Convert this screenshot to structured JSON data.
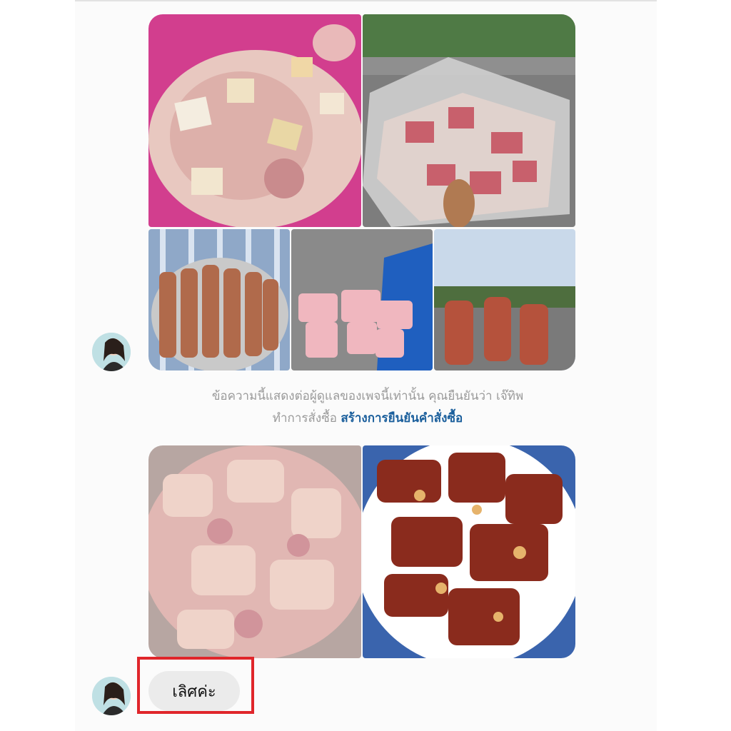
{
  "notice": {
    "line1": "ข้อความนี้แสดงต่อผู้ดูแลของเพจนี้เท่านั้น คุณยืนยันว่า เจ๊ทิพ",
    "line2_prefix": "ทำการสั่งซื้อ",
    "link": "สร้างการยืนยันคำสั่งซื้อ"
  },
  "message": {
    "text": "เลิศค่ะ"
  },
  "colors": {
    "highlight": "#e0262b",
    "link": "#1b5f9c",
    "notice_text": "#9a9a9a",
    "bubble": "#ebebeb"
  },
  "icons": [
    "avatar-photo"
  ]
}
